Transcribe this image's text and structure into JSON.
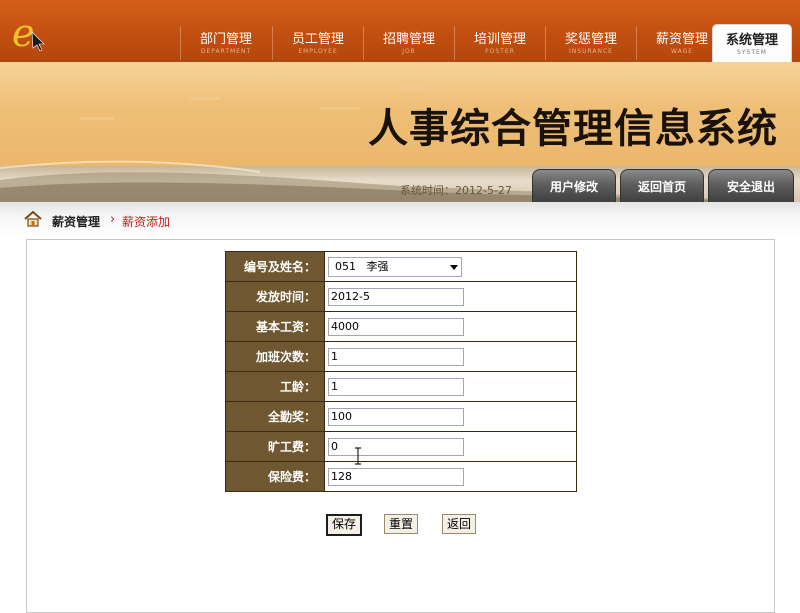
{
  "header": {
    "logo_glyph": "e",
    "nav": [
      {
        "zh": "部门管理",
        "en": "DEPARTMENT"
      },
      {
        "zh": "员工管理",
        "en": "EMPLOYEE"
      },
      {
        "zh": "招聘管理",
        "en": "JOB"
      },
      {
        "zh": "培训管理",
        "en": "FOSTER"
      },
      {
        "zh": "奖惩管理",
        "en": "INSURANCE"
      },
      {
        "zh": "薪资管理",
        "en": "WAGE"
      },
      {
        "zh": "系统管理",
        "en": "SYSTEM",
        "active": true
      }
    ]
  },
  "banner": {
    "title": "人事综合管理信息系统",
    "system_time_label": "系统时间：",
    "system_time": "2012-5-27",
    "buttons": {
      "user_edit": "用户修改",
      "home": "返回首页",
      "logout": "安全退出"
    }
  },
  "breadcrumb": {
    "parent": "薪资管理",
    "current": "薪资添加"
  },
  "form": {
    "employee": {
      "label": "编号及姓名：",
      "value": "051   李强"
    },
    "issue_date": {
      "label": "发放时间：",
      "value": "2012-5"
    },
    "base_salary": {
      "label": "基本工资：",
      "value": "4000"
    },
    "overtime_count": {
      "label": "加班次数：",
      "value": "1"
    },
    "seniority": {
      "label": "工龄：",
      "value": "1"
    },
    "attendance_bonus": {
      "label": "全勤奖：",
      "value": "100"
    },
    "absence_fee": {
      "label": "旷工费：",
      "value": "0"
    },
    "insurance_fee": {
      "label": "保险费：",
      "value": "128"
    }
  },
  "actions": {
    "save": "保存",
    "reset": "重置",
    "back": "返回"
  },
  "colors": {
    "nav_bg": "#c24f10",
    "banner_bg": "#efbf77",
    "label_cell_bg": "#6e5731",
    "breadcrumb_current": "#c81818"
  }
}
